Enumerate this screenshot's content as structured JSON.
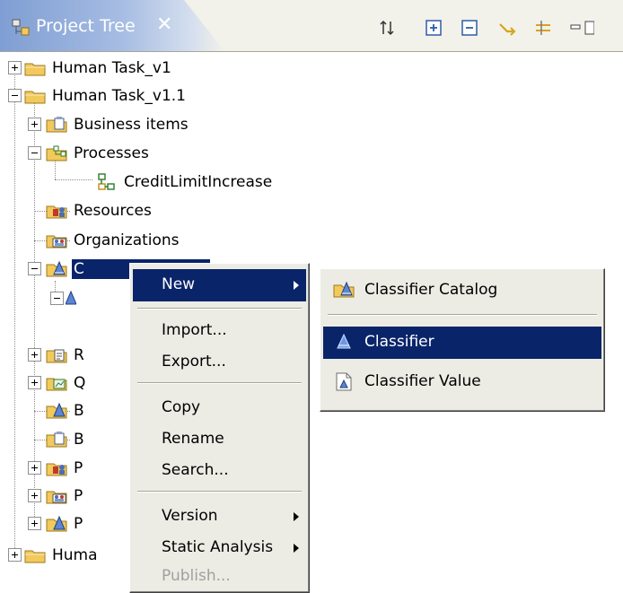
{
  "view": {
    "title": "Project Tree",
    "close_glyph": "✕",
    "icons": [
      "project-tree-icon",
      "close-icon",
      "sort-icon",
      "expand-all-icon",
      "collapse-all-icon",
      "link-with-editor-icon",
      "filter-icon",
      "minimize-icon"
    ]
  },
  "tree": {
    "items": [
      {
        "label": "Human Task_v1",
        "expander": "plus",
        "icon": "folder-icon"
      },
      {
        "label": "Human Task_v1.1",
        "expander": "minus",
        "icon": "folder-icon"
      },
      {
        "label": "Business items",
        "expander": "plus",
        "icon": "business-items-folder-icon"
      },
      {
        "label": "Processes",
        "expander": "minus",
        "icon": "processes-folder-icon"
      },
      {
        "label": "CreditLimitIncrease",
        "expander": "none",
        "icon": "process-icon"
      },
      {
        "label": "Resources",
        "expander": "none",
        "icon": "resources-folder-icon"
      },
      {
        "label": "Organizations",
        "expander": "none",
        "icon": "organizations-folder-icon"
      },
      {
        "label": "Classifiers",
        "visible_label": "C",
        "expander": "minus",
        "icon": "classifiers-folder-icon",
        "selected": true
      },
      {
        "label": "R",
        "expander": "plus",
        "icon": "reports-folder-icon"
      },
      {
        "label": "Q",
        "expander": "plus",
        "icon": "queries-folder-icon"
      },
      {
        "label": "B",
        "expander": "none",
        "icon": "classifier-catalog-icon"
      },
      {
        "label": "B",
        "expander": "none",
        "icon": "business-items-folder-icon"
      },
      {
        "label": "P",
        "expander": "plus",
        "icon": "resources-folder-icon"
      },
      {
        "label": "P",
        "expander": "plus",
        "icon": "organizations-folder-icon"
      },
      {
        "label": "P",
        "expander": "plus",
        "icon": "classifiers-folder-icon"
      },
      {
        "label": "Huma",
        "expander": "plus",
        "icon": "folder-icon"
      }
    ]
  },
  "context_menu": {
    "items": [
      {
        "label": "New",
        "has_submenu": true,
        "highlighted": true
      },
      {
        "label": "Import..."
      },
      {
        "label": "Export..."
      },
      {
        "label": "Copy"
      },
      {
        "label": "Rename"
      },
      {
        "label": "Search..."
      },
      {
        "label": "Version",
        "has_submenu": true
      },
      {
        "label": "Static Analysis",
        "has_submenu": true
      },
      {
        "label": "Publish...",
        "disabled": true
      }
    ]
  },
  "submenu": {
    "items": [
      {
        "label": "Classifier Catalog",
        "icon": "classifier-catalog-icon"
      },
      {
        "label": "Classifier",
        "icon": "classifier-icon",
        "highlighted": true
      },
      {
        "label": "Classifier Value",
        "icon": "classifier-value-icon"
      }
    ]
  },
  "colors": {
    "selection": "#0a246a",
    "tab_gradient_start": "#7f9ed3",
    "menu_background": "#ecece5",
    "folder_yellow": "#f2c95b"
  }
}
